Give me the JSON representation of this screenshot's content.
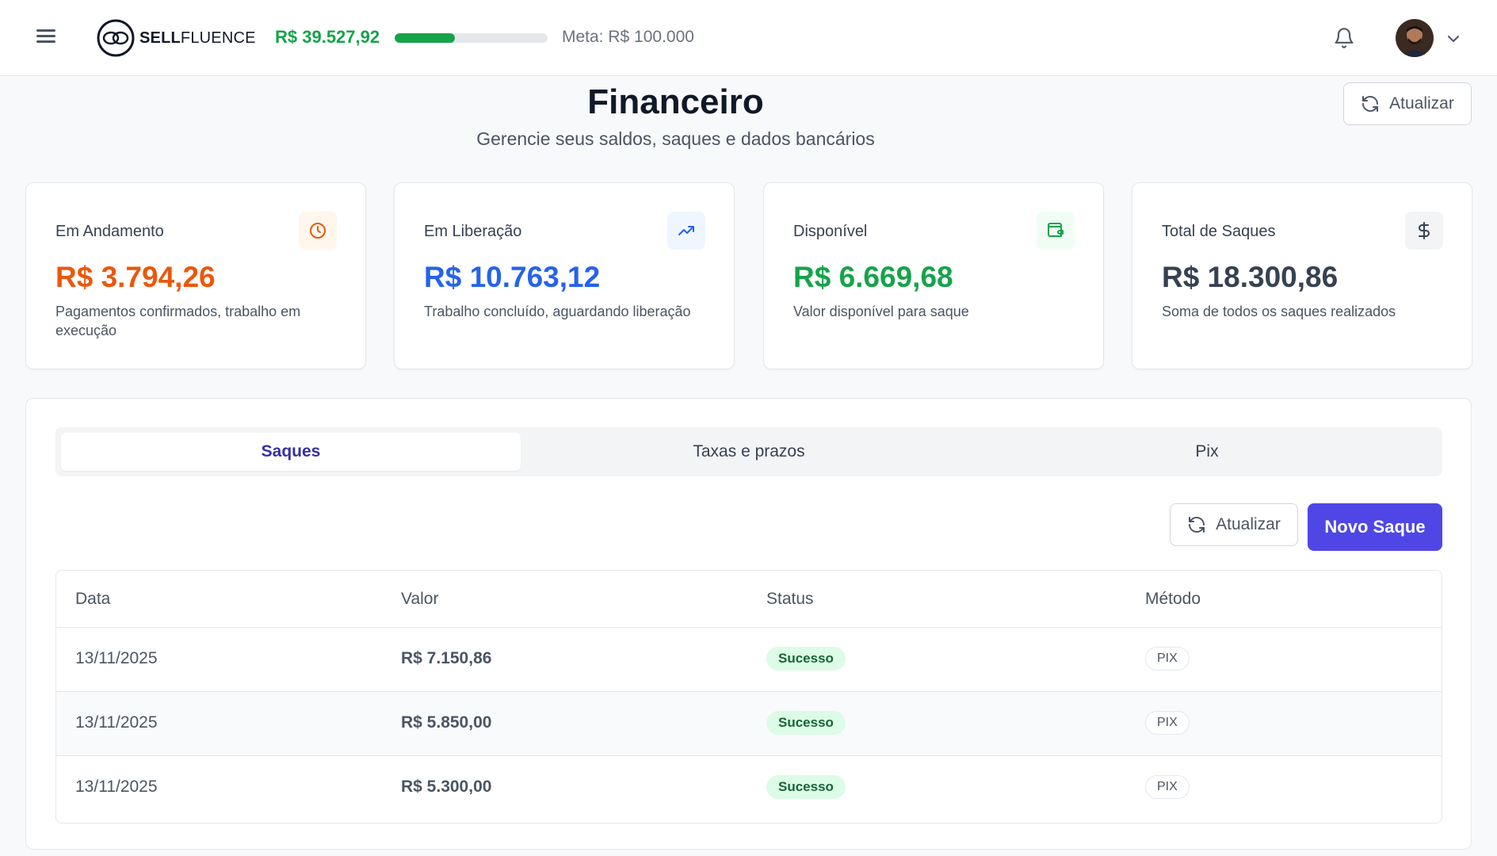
{
  "header": {
    "brand_bold": "SELL",
    "brand_rest": "FLUENCE",
    "goal_current": "R$ 39.527,92",
    "goal_progress": 0.395,
    "goal_meta": "Meta: R$ 100.000"
  },
  "page": {
    "title": "Financeiro",
    "subtitle": "Gerencie seus saldos, saques e dados bancários",
    "refresh_label": "Atualizar"
  },
  "cards": [
    {
      "label": "Em Andamento",
      "value": "R$ 3.794,26",
      "desc": "Pagamentos confirmados, trabalho em execução",
      "color": "#ea580c",
      "icon": "clock-icon",
      "icon_bg": "#fff7ed"
    },
    {
      "label": "Em Liberação",
      "value": "R$ 10.763,12",
      "desc": "Trabalho concluído, aguardando liberação",
      "color": "#2563eb",
      "icon": "trending-up-icon",
      "icon_bg": "#eff6ff"
    },
    {
      "label": "Disponível",
      "value": "R$ 6.669,68",
      "desc": "Valor disponível para saque",
      "color": "#16a34a",
      "icon": "wallet-icon",
      "icon_bg": "#f0fdf4"
    },
    {
      "label": "Total de Saques",
      "value": "R$ 18.300,86",
      "desc": "Soma de todos os saques realizados",
      "color": "#374151",
      "icon": "dollar-icon",
      "icon_bg": "#f3f4f6"
    }
  ],
  "tabs": [
    {
      "label": "Saques",
      "active": true
    },
    {
      "label": "Taxas e prazos",
      "active": false
    },
    {
      "label": "Pix",
      "active": false
    }
  ],
  "actions": {
    "refresh_label": "Atualizar",
    "new_withdraw_label": "Novo Saque"
  },
  "table": {
    "columns": [
      "Data",
      "Valor",
      "Status",
      "Método"
    ],
    "rows": [
      {
        "date": "13/11/2025",
        "value": "R$ 7.150,86",
        "status": "Sucesso",
        "method": "PIX"
      },
      {
        "date": "13/11/2025",
        "value": "R$ 5.850,00",
        "status": "Sucesso",
        "method": "PIX"
      },
      {
        "date": "13/11/2025",
        "value": "R$ 5.300,00",
        "status": "Sucesso",
        "method": "PIX"
      }
    ]
  }
}
